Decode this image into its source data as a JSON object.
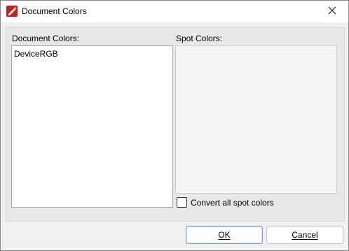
{
  "window": {
    "title": "Document Colors",
    "icon": "pdf-editor-app-icon",
    "close_icon": "close-icon"
  },
  "document_colors": {
    "label": "Document Colors:",
    "items": [
      "DeviceRGB"
    ]
  },
  "spot_colors": {
    "label": "Spot Colors:",
    "items": []
  },
  "convert_checkbox": {
    "label": "Convert all spot colors",
    "checked": false
  },
  "buttons": {
    "ok": "OK",
    "cancel": "Cancel"
  },
  "colors": {
    "app_icon": "#c81e1e",
    "default_button_border": "#6aa3de"
  }
}
